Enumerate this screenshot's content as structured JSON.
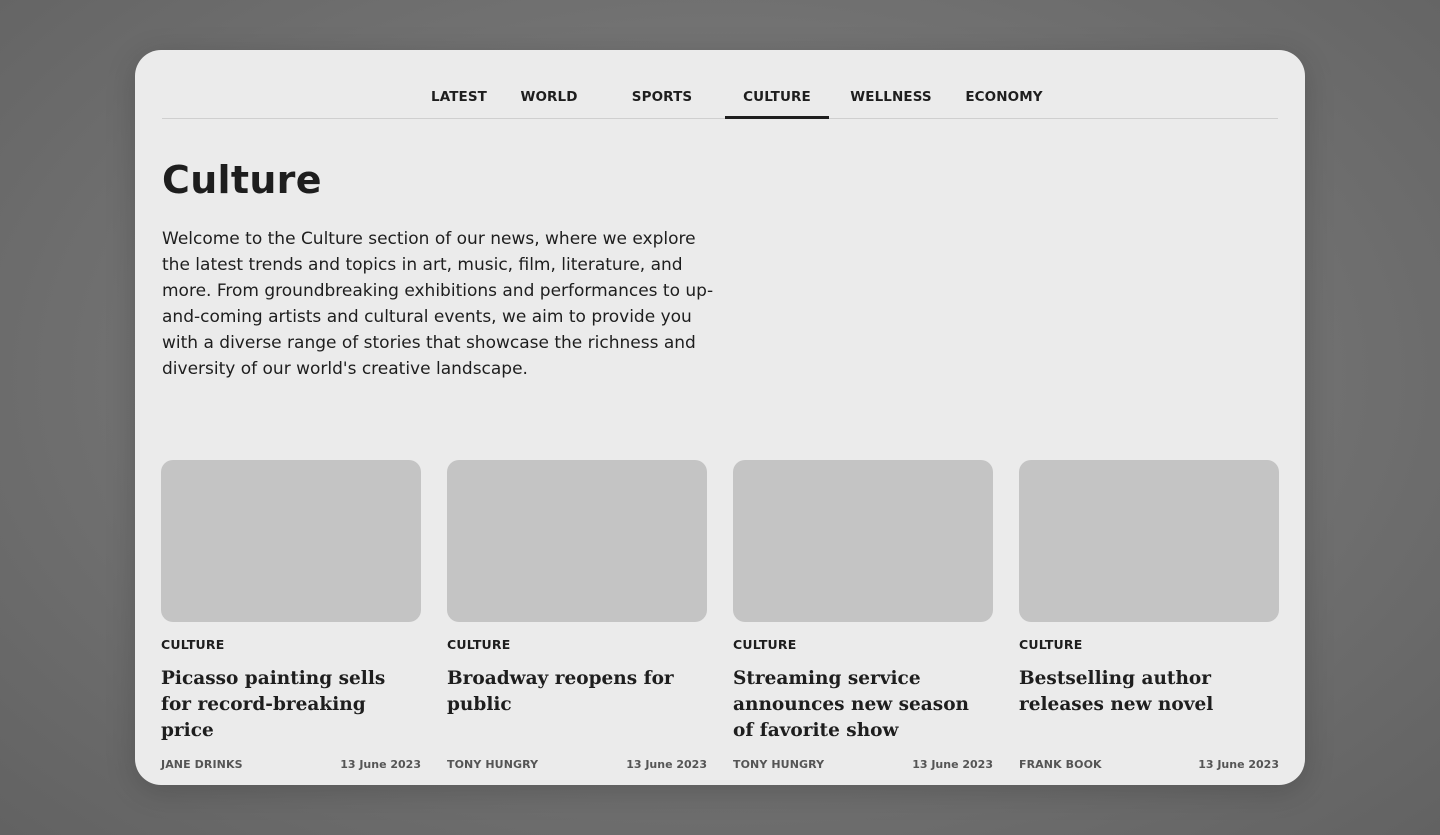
{
  "nav": {
    "tabs": [
      {
        "label": "LATEST"
      },
      {
        "label": "WORLD"
      },
      {
        "label": "SPORTS"
      },
      {
        "label": "CULTURE",
        "active": true
      },
      {
        "label": "WELLNESS"
      },
      {
        "label": "ECONOMY"
      }
    ]
  },
  "page": {
    "title": "Culture",
    "intro": "Welcome to the Culture section of our news, where we explore the latest trends and topics in art, music, film, literature, and more. From groundbreaking exhibitions and performances to up-and-coming artists and cultural events, we aim to provide you with a diverse range of stories that showcase the richness and diversity of our world's creative landscape."
  },
  "articles": [
    {
      "category": "CULTURE",
      "title": "Picasso painting sells for record-breaking price",
      "author": "JANE DRINKS",
      "date": "13 June 2023"
    },
    {
      "category": "CULTURE",
      "title": "Broadway reopens for public",
      "author": "TONY HUNGRY",
      "date": "13 June 2023"
    },
    {
      "category": "CULTURE",
      "title": "Streaming service announces new season of favorite show",
      "author": "TONY HUNGRY",
      "date": "13 June 2023"
    },
    {
      "category": "CULTURE",
      "title": "Bestselling author releases new novel",
      "author": "FRANK BOOK",
      "date": "13 June 2023"
    }
  ],
  "colors": {
    "panel_background": "#ebebeb",
    "text": "#1e1e1e",
    "image_placeholder": "#c4c4c4",
    "meta_text": "#555555"
  }
}
